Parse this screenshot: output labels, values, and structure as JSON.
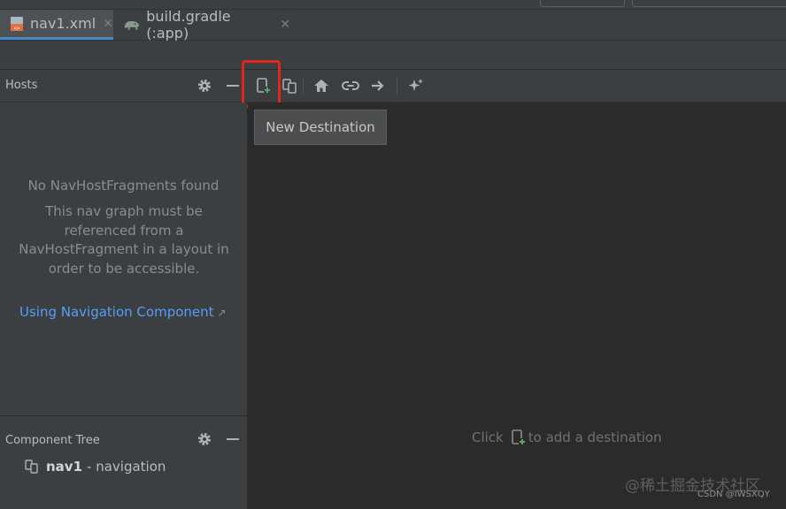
{
  "tabs": [
    {
      "label": "nav1.xml",
      "active": true,
      "icon": "xml-file-icon"
    },
    {
      "label": "build.gradle (:app)",
      "active": false,
      "icon": "gradle-elephant-icon"
    }
  ],
  "hosts": {
    "title": "Hosts",
    "empty_title": "No NavHostFragments found",
    "empty_desc": "This nav graph must be referenced from a NavHostFragment in a layout in order to be accessible.",
    "link": "Using Navigation Component",
    "link_arrow": "↗"
  },
  "toolbar": {
    "icons": [
      "gear-icon",
      "minus-icon",
      "new-destination-icon",
      "nested-graph-icon",
      "home-icon",
      "link-icon",
      "arrow-right-icon",
      "magic-sparkle-icon"
    ],
    "tooltip": "New Destination"
  },
  "component_tree": {
    "title": "Component Tree",
    "item_name": "nav1",
    "item_type": "- navigation"
  },
  "canvas": {
    "hint_before": "Click",
    "hint_after": "to add a destination"
  },
  "watermark": "@稀土掘金技术社区",
  "credit": "CSDN @IWSXQY",
  "colors": {
    "accent": "#4a88c7",
    "link": "#589df6",
    "highlight": "#e0261d",
    "green": "#59a869"
  }
}
